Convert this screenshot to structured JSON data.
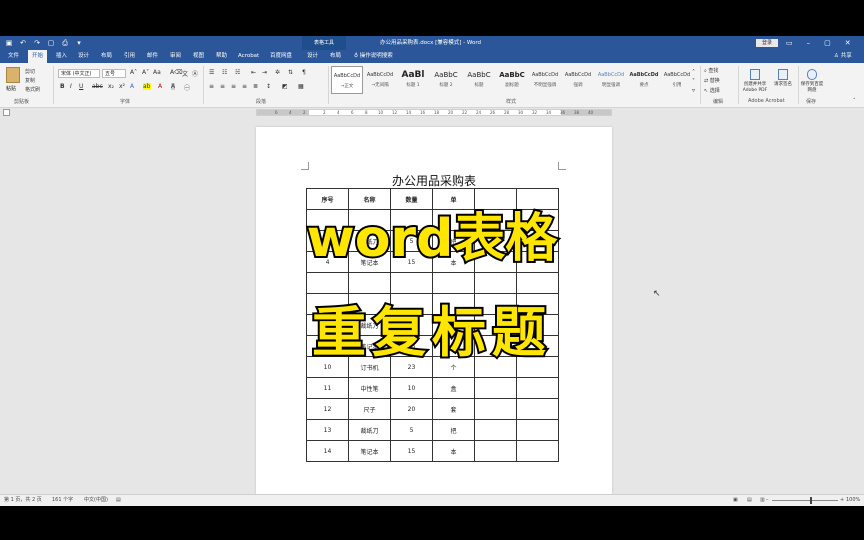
{
  "titlebar": {
    "context_tools": "表格工具",
    "doc_title": "办公用品采购表.docx [兼容模式] - Word",
    "login": "登录"
  },
  "tabs": [
    "文件",
    "开始",
    "插入",
    "设计",
    "布局",
    "引用",
    "邮件",
    "审阅",
    "视图",
    "帮助",
    "Acrobat",
    "百度网盘",
    "设计",
    "布局"
  ],
  "active_tab_index": 1,
  "tellme": "操作说明搜索",
  "share": "共享",
  "ribbon": {
    "clipboard": {
      "paste": "粘贴",
      "cut": "剪切",
      "copy": "复制",
      "painter": "格式刷",
      "label": "剪贴板"
    },
    "font": {
      "name": "宋体 (中文正)",
      "size": "五号",
      "label": "字体"
    },
    "paragraph": {
      "label": "段落"
    },
    "styles": {
      "label": "样式",
      "items": [
        {
          "preview": "AaBbCcDd",
          "name": "→正文"
        },
        {
          "preview": "AaBbCcDd",
          "name": "→无间隔"
        },
        {
          "preview": "AaBl",
          "name": "标题 1"
        },
        {
          "preview": "AaBbC",
          "name": "标题 2"
        },
        {
          "preview": "AaBbC",
          "name": "标题"
        },
        {
          "preview": "AaBbC",
          "name": "副标题"
        },
        {
          "preview": "AaBbCcDd",
          "name": "不明显强调"
        },
        {
          "preview": "AaBbCcDd",
          "name": "强调"
        },
        {
          "preview": "AaBbCcDd",
          "name": "明显强调"
        },
        {
          "preview": "AaBbCcDd",
          "name": "要点"
        },
        {
          "preview": "AaBbCcDd",
          "name": "引用"
        }
      ]
    },
    "editing": {
      "find": "查找",
      "replace": "替换",
      "select": "选择",
      "label": "编辑"
    },
    "acrobat": {
      "create": "创建并共享 Adobe PDF",
      "request": "请求签名",
      "label": "Adobe Acrobat"
    },
    "baidu": {
      "save": "保存到百度网盘",
      "label": "保存"
    }
  },
  "document": {
    "heading": "办公用品采购表",
    "headers": [
      "序号",
      "名称",
      "数量",
      "单",
      "",
      ""
    ],
    "rows": [
      [
        "3",
        "裁纸刀",
        "5",
        "把",
        "",
        ""
      ],
      [
        "4",
        "笔记本",
        "15",
        "本",
        "",
        ""
      ],
      [
        "",
        "",
        "",
        "",
        "",
        ""
      ],
      [
        "8",
        "裁纸刀",
        "5",
        "把",
        "",
        ""
      ],
      [
        "9",
        "笔记本",
        "15",
        "本",
        "",
        ""
      ],
      [
        "10",
        "订书机",
        "23",
        "个",
        "",
        ""
      ],
      [
        "11",
        "中性笔",
        "10",
        "盒",
        "",
        ""
      ],
      [
        "12",
        "尺子",
        "20",
        "套",
        "",
        ""
      ],
      [
        "13",
        "裁纸刀",
        "5",
        "把",
        "",
        ""
      ],
      [
        "14",
        "笔记本",
        "15",
        "本",
        "",
        ""
      ]
    ]
  },
  "overlay": {
    "line1": "word表格",
    "line2": "重复标题"
  },
  "statusbar": {
    "page": "第 1 页，共 2 页",
    "words": "161 个字",
    "lang": "中文(中国)",
    "zoom": "100%"
  }
}
